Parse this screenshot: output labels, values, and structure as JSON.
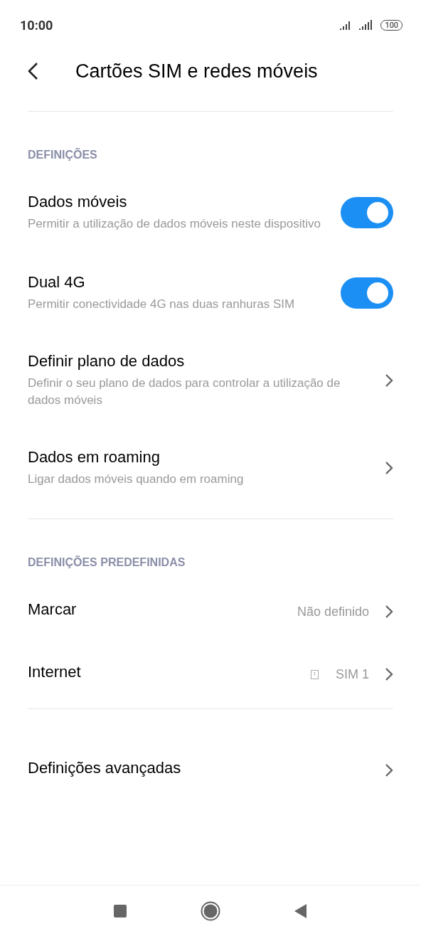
{
  "status_bar": {
    "time": "10:00",
    "battery": "100"
  },
  "header": {
    "title": "Cartões SIM e redes móveis"
  },
  "sections": [
    {
      "title": "DEFINIÇÕES",
      "items": [
        {
          "kind": "toggle",
          "title": "Dados móveis",
          "subtitle": "Permitir a utilização de dados móveis neste dispositivo",
          "on": true
        },
        {
          "kind": "toggle",
          "title": "Dual 4G",
          "subtitle": "Permitir conectividade 4G nas duas ranhuras SIM",
          "on": true
        },
        {
          "kind": "link",
          "title": "Definir plano de dados",
          "subtitle": "Definir o seu plano de dados para controlar a utilização de dados móveis"
        },
        {
          "kind": "link",
          "title": "Dados em roaming",
          "subtitle": "Ligar dados móveis quando em roaming"
        }
      ]
    },
    {
      "title": "DEFINIÇÕES PREDEFINIDAS",
      "items": [
        {
          "kind": "value",
          "title": "Marcar",
          "value": "Não definido"
        },
        {
          "kind": "value",
          "title": "Internet",
          "value": "SIM 1",
          "sim_slot": "1"
        }
      ]
    },
    {
      "items": [
        {
          "kind": "link",
          "title": "Definições avançadas"
        }
      ]
    }
  ]
}
